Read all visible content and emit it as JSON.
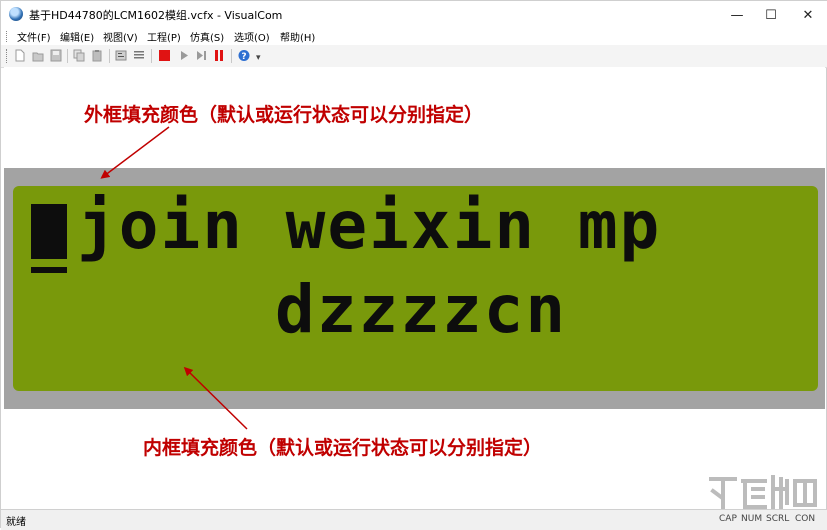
{
  "window": {
    "title": "基于HD44780的LCM1602模组.vcfx - VisualCom",
    "controls": {
      "minimize": "—",
      "maximize": "☐",
      "close": "✕"
    }
  },
  "menu": {
    "items": [
      "文件(F)",
      "编辑(E)",
      "视图(V)",
      "工程(P)",
      "仿真(S)",
      "选项(O)",
      "帮助(H)"
    ]
  },
  "toolbar": {
    "buttons": [
      "new-icon",
      "open-icon",
      "save-icon",
      "copy-icon",
      "paste-icon",
      "properties-icon",
      "list-icon",
      "stop-icon",
      "run-icon",
      "step-icon",
      "pause-icon",
      "help-icon"
    ],
    "overflow": "▾"
  },
  "lcd": {
    "line1": "join weixin mp",
    "line2": "dzzzzcn",
    "colors": {
      "outer_frame": "#a3a3a3",
      "inner_frame": "#79990b",
      "pixel": "#0d0d0d"
    }
  },
  "annotations": {
    "outer": "外框填充颜色（默认或运行状态可以分别指定）",
    "inner": "内框填充颜色（默认或运行状态可以分别指定）",
    "color": "#c00000"
  },
  "status": {
    "text": "就绪",
    "indicators": [
      "CAP",
      "NUM",
      "SCRL",
      "CON"
    ]
  }
}
